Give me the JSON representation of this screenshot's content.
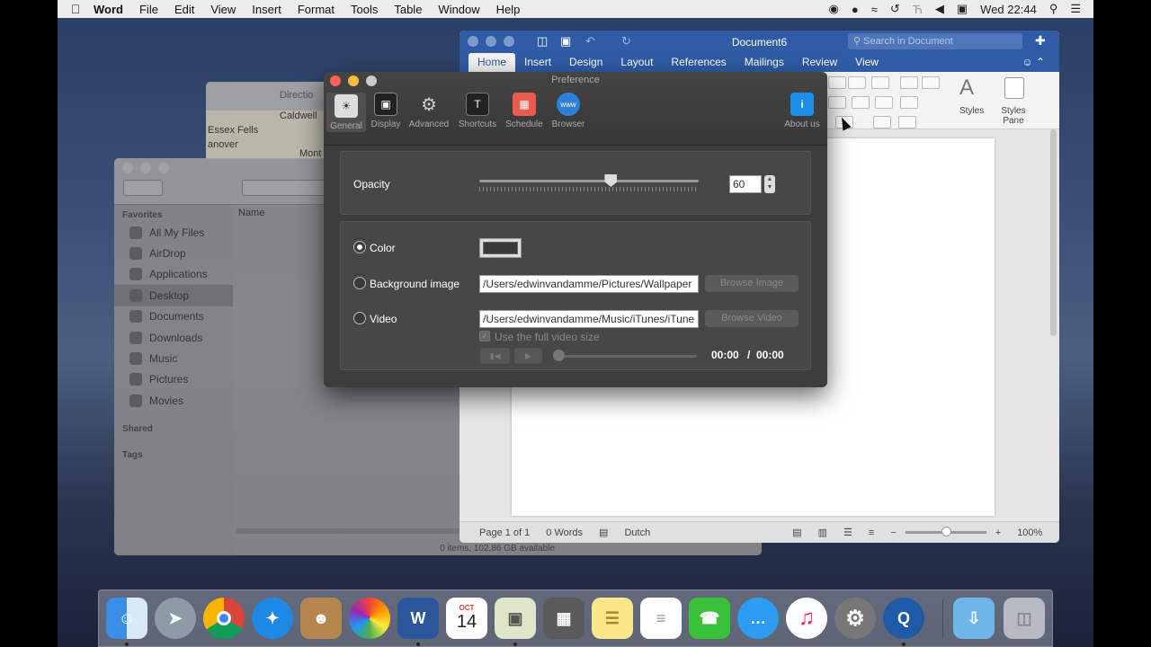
{
  "menubar": {
    "app_name": "Word",
    "items": [
      "File",
      "Edit",
      "View",
      "Insert",
      "Format",
      "Tools",
      "Table",
      "Window",
      "Help"
    ],
    "clock": "Wed 22:44"
  },
  "finder": {
    "favorites_header": "Favorites",
    "favorites": [
      "All My Files",
      "AirDrop",
      "Applications",
      "Desktop",
      "Documents",
      "Downloads",
      "Music",
      "Pictures",
      "Movies"
    ],
    "selected": "Desktop",
    "shared_header": "Shared",
    "tags_header": "Tags",
    "column_name": "Name",
    "status": "0 items, 102,86 GB available"
  },
  "maps": {
    "title": "Directio",
    "labels": [
      "Caldwell",
      "Essex Fells",
      "anover",
      "Mont"
    ]
  },
  "word": {
    "title": "Document6",
    "search_placeholder": "Search in Document",
    "tabs": [
      "Home",
      "Insert",
      "Design",
      "Layout",
      "References",
      "Mailings",
      "Review",
      "View"
    ],
    "active_tab": "Home",
    "styles_label": "Styles",
    "styles_pane_label": "Styles Pane",
    "status": {
      "page": "Page 1 of 1",
      "words": "0 Words",
      "language": "Dutch",
      "zoom": "100%"
    }
  },
  "preference": {
    "title": "Preference",
    "toolbar": [
      "General",
      "Display",
      "Advanced",
      "Shortcuts",
      "Schedule",
      "Browser"
    ],
    "about": "About us",
    "opacity_label": "Opacity",
    "opacity_value": "60",
    "opacity_fraction": 0.6,
    "color_label": "Color",
    "bg_image_label": "Background image",
    "bg_image_path": "/Users/edwinvandamme/Pictures/Wallpaper",
    "browse_image": "Browse Image",
    "video_label": "Video",
    "video_path": "/Users/edwinvandamme/Music/iTunes/iTune",
    "browse_video": "Browse Video",
    "full_video_size": "Use the full video size",
    "time_current": "00:00",
    "time_separator": "/",
    "time_total": "00:00",
    "selected_option": "Color"
  },
  "dock": {
    "apps": [
      "Finder",
      "Launchpad",
      "Chrome",
      "Safari",
      "Contacts",
      "Photos",
      "Word",
      "Calendar",
      "Preview",
      "Calculator",
      "Notes",
      "Reminders",
      "FaceTime",
      "Messages",
      "iTunes",
      "System Preferences",
      "QuickTime",
      "Downloads",
      "Trash"
    ],
    "calendar_month": "OCT",
    "calendar_day": "14"
  }
}
